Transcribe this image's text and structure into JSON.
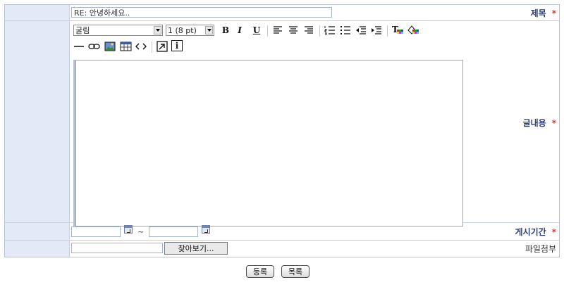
{
  "form": {
    "title": {
      "label": "제목",
      "value": "RE: 안녕하세요.."
    },
    "content": {
      "label": "글내용"
    },
    "period": {
      "label": "게시기간",
      "start_value": "",
      "end_value": "",
      "separator": "~"
    },
    "attachment": {
      "label": "파일첨부",
      "value": "",
      "browse_label": "찾아보기..."
    },
    "required_mark": "*"
  },
  "toolbar": {
    "font": {
      "value": "굴림"
    },
    "size": {
      "value": "1 (8 pt)"
    },
    "bold": "B",
    "italic": "I",
    "underline": "U",
    "text_color": "T",
    "info": "i",
    "icons": [
      "bold-icon",
      "italic-icon",
      "underline-icon",
      "align-left-icon",
      "align-center-icon",
      "align-right-icon",
      "ordered-list-icon",
      "unordered-list-icon",
      "outdent-icon",
      "indent-icon",
      "text-color-icon",
      "highlight-color-icon",
      "horizontal-rule-icon",
      "link-icon",
      "image-icon",
      "table-icon",
      "html-source-icon",
      "popup-icon",
      "info-icon"
    ]
  },
  "actions": {
    "submit": "등록",
    "list": "목록"
  }
}
